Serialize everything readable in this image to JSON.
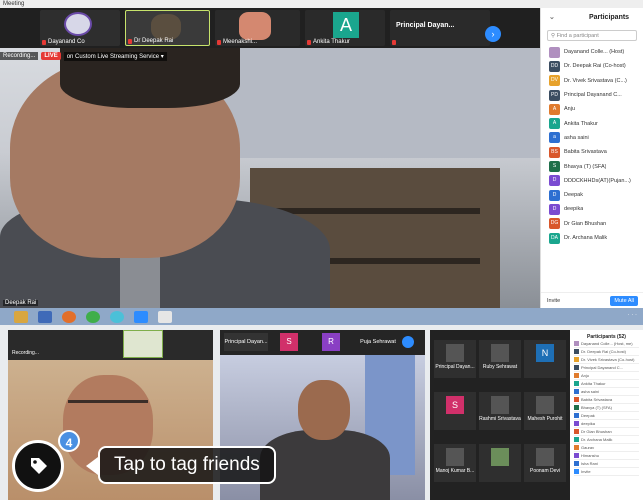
{
  "window": {
    "title": "Meeting"
  },
  "thumbnails": [
    {
      "label": "Dayanand Co"
    },
    {
      "label": "Dr Deepak Rai"
    },
    {
      "label": "Meenakshi..."
    },
    {
      "label": "Ankita Thakur",
      "avatar": "A"
    },
    {
      "label": "Principal Dayan..."
    }
  ],
  "main_video": {
    "recording_label": "Recording...",
    "live_badge": "LIVE",
    "live_service": "on Custom Live Streaming Service ▾",
    "speaker": "Deepak Rai"
  },
  "participants_panel": {
    "title": "Participants",
    "search_placeholder": "Find a participant",
    "participants": [
      {
        "initials": "",
        "name": "Dayanand Colle... (Host)",
        "color": "#b08fbf"
      },
      {
        "initials": "DD",
        "name": "Dr. Deepak Rai (Co-host)",
        "color": "#3b4d61"
      },
      {
        "initials": "DV",
        "name": "Dr. Vivek Srivastava (C...)",
        "color": "#e7a22b"
      },
      {
        "initials": "PD",
        "name": "Principal Dayanand C...",
        "color": "#3b4d61"
      },
      {
        "initials": "A",
        "name": "Anju",
        "color": "#e07b2d"
      },
      {
        "initials": "A",
        "name": "Ankita Thakur",
        "color": "#1aa68e"
      },
      {
        "initials": "a",
        "name": "asha saini",
        "color": "#2d6fd1"
      },
      {
        "initials": "BS",
        "name": "Babita Srivastava",
        "color": "#d9572b"
      },
      {
        "initials": "S",
        "name": "Bhavya (T) (SFA)",
        "color": "#1f6f4a"
      },
      {
        "initials": "D",
        "name": "DDDCKHHDs(AT)(Pujan...)",
        "color": "#7a4bd1"
      },
      {
        "initials": "D",
        "name": "Deepak",
        "color": "#2d6fd1"
      },
      {
        "initials": "D",
        "name": "deepika",
        "color": "#7a4bd1"
      },
      {
        "initials": "DG",
        "name": "Dr Gian Bhushan",
        "color": "#d9572b"
      },
      {
        "initials": "DA",
        "name": "Dr. Archana Malik",
        "color": "#1aa68e"
      }
    ],
    "invite_label": "Invite",
    "mute_all_label": "Mute All"
  },
  "taskbar": {
    "tray_text": "· · ·"
  },
  "bottom_panels": {
    "b1": {
      "rec": "Recording..."
    },
    "b2": {
      "tiles": [
        "Principal Dayan...",
        "S",
        "R",
        "Puja Sehrawat"
      ]
    },
    "b3": {
      "cells": [
        {
          "label": "Principal Dayan...",
          "av": "",
          "color": "#555"
        },
        {
          "label": "Ruby Sehrawat",
          "av": "",
          "color": "#555"
        },
        {
          "label": "",
          "av": "N",
          "color": "#1e6fb5"
        },
        {
          "label": "",
          "av": "S",
          "color": "#d1306a"
        },
        {
          "label": "Rashmi Srivastava",
          "av": "",
          "color": "#555"
        },
        {
          "label": "Mahesh Purohit",
          "av": "",
          "color": "#555"
        },
        {
          "label": "Manoj Kumar B...",
          "av": "",
          "color": "#555"
        },
        {
          "label": "",
          "av": "",
          "color": "#6b8e5a"
        },
        {
          "label": "Poonam Devi",
          "av": "",
          "color": "#555"
        }
      ],
      "panel_title": "Participants (52)",
      "rows": [
        "Dayanand Colle... (Host, me)",
        "Dr. Deepak Rai (Co-host)",
        "Dr. Vivek Srivastava (Co-host)",
        "Principal Dayanand C...",
        "Anju",
        "Ankita Thakur",
        "asha saini",
        "Babita Srivastava",
        "Bhavya (T) (SFA)",
        "Deepak",
        "deepika",
        "Dr Gian Bhushan",
        "Dr. Archana Malik",
        "Gaurav",
        "Himanshu",
        "Isha Rani",
        "Invite"
      ]
    }
  },
  "tag_overlay": {
    "count": "4",
    "tooltip": "Tap to tag friends"
  }
}
